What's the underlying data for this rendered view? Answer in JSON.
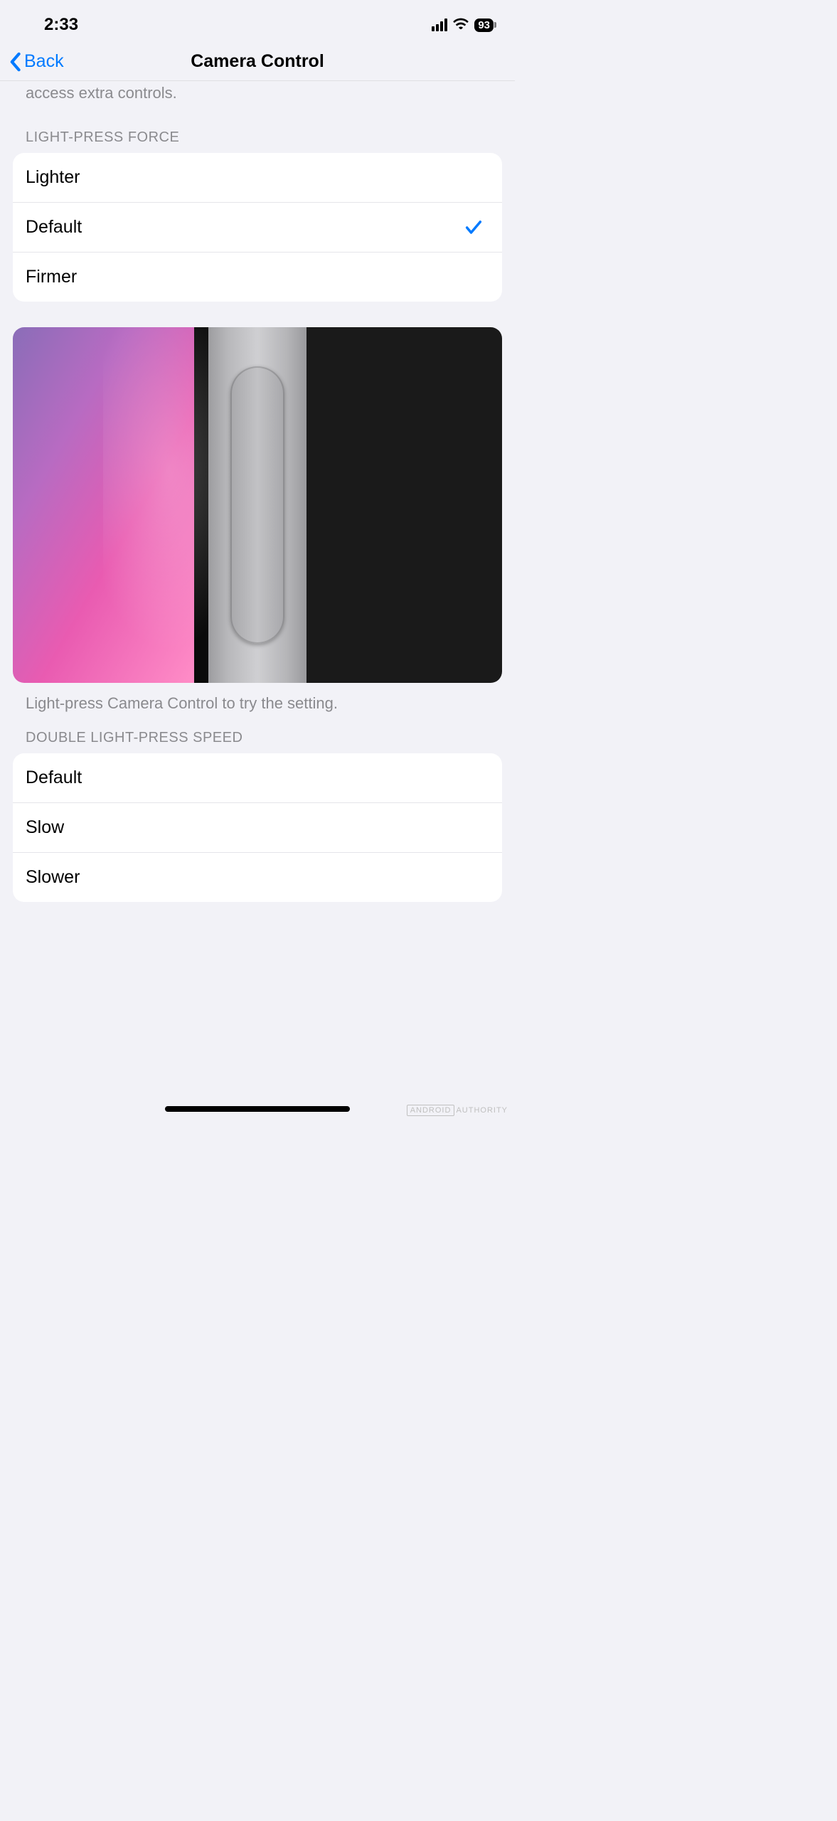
{
  "statusBar": {
    "time": "2:33",
    "battery": "93"
  },
  "nav": {
    "backLabel": "Back",
    "title": "Camera Control"
  },
  "partialText": "access extra controls.",
  "sections": {
    "lightPressForce": {
      "header": "LIGHT-PRESS FORCE",
      "options": [
        {
          "label": "Lighter",
          "selected": false
        },
        {
          "label": "Default",
          "selected": true
        },
        {
          "label": "Firmer",
          "selected": false
        }
      ]
    },
    "previewCaption": "Light-press Camera Control to try the setting.",
    "doublePressSpeed": {
      "header": "DOUBLE LIGHT-PRESS SPEED",
      "options": [
        {
          "label": "Default",
          "selected": false
        },
        {
          "label": "Slow",
          "selected": false
        },
        {
          "label": "Slower",
          "selected": false
        }
      ]
    }
  },
  "watermark": {
    "brand": "ANDROID",
    "suffix": "AUTHORITY"
  }
}
